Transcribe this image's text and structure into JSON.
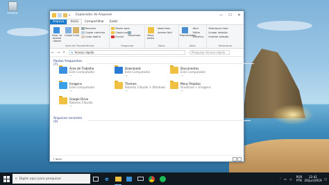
{
  "desktop": {
    "recycle_bin_label": "Lixeira"
  },
  "window": {
    "title": "Explorador de Arquivos",
    "controls": {
      "minimize": "—",
      "maximize": "☐",
      "close": "✕"
    },
    "tabs": [
      "Arquivo",
      "Início",
      "Compartilhar",
      "Exibir"
    ],
    "ribbon": {
      "pin_label": "Fixar no Acesso rápido",
      "copy_label": "Copiar",
      "paste_label": "Colar",
      "copy_path": "Copiar caminho",
      "paste_shortcut": "Colar atalho",
      "cut": "Recortar",
      "move_to": "Mover para",
      "copy_to": "Copiar para",
      "delete": "Excluir",
      "rename": "Renomear",
      "new_folder": "Nova pasta",
      "new_item": "Novo item",
      "easy_access": "Acesso fácil",
      "properties": "Propriedades",
      "open": "Abrir",
      "edit": "Editar",
      "history": "Histórico",
      "select_all": "Selecionar tudo",
      "select_none": "Limpar seleção",
      "invert": "Inverter seleção",
      "select": "Selecionar",
      "groups": [
        "Área de Transferência",
        "Organizar",
        "Novo",
        "Abrir",
        "Selecionar"
      ]
    },
    "address": {
      "back": "←",
      "forward": "→",
      "up": "↑",
      "path": "Acesso rápido",
      "search_placeholder": "Pesquisar Acesso rápido"
    },
    "sections": {
      "frequent": "Pastas frequentes (7)",
      "recent": "Arquivos recentes (0)"
    },
    "folders": [
      {
        "name": "Área de Trabalho",
        "location": "Este Computador",
        "color": "#3d8fe0"
      },
      {
        "name": "Downloads",
        "location": "Este Computador",
        "color": "#2b7bd6"
      },
      {
        "name": "Documentos",
        "location": "Este Computador",
        "color": "#f0c040"
      },
      {
        "name": "Imagens",
        "location": "Este Computador",
        "color": "#3aa0e8"
      },
      {
        "name": "Themes",
        "location": "Roberto Cláudio > Windows",
        "color": "#f0c040"
      },
      {
        "name": "Meus Projetos",
        "location": "OneDrive > Imagens",
        "color": "#f0c040"
      },
      {
        "name": "Google Drive",
        "location": "Roberto Cláudio",
        "color": "#f0c040"
      }
    ],
    "status": "7 itens"
  },
  "taskbar": {
    "search_placeholder": "Digite aqui para pesquisar",
    "lang_top": "POR",
    "lang_bottom": "PTB",
    "time": "22:41",
    "date": "20/jun/2019"
  }
}
